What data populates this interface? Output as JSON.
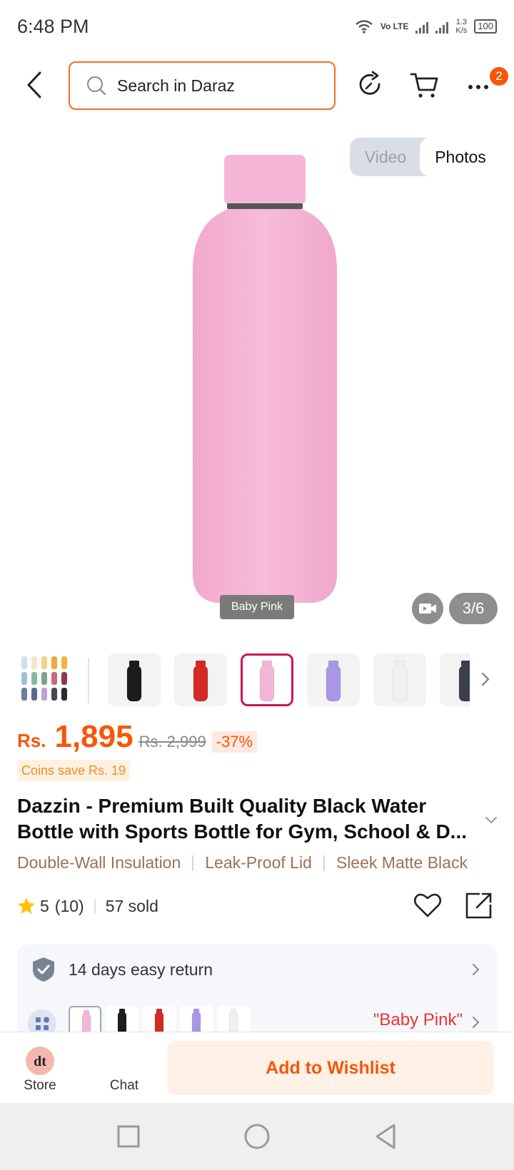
{
  "status_bar": {
    "time": "6:48 PM",
    "network": "Vo LTE",
    "speed_value": "1.3",
    "speed_unit": "K/s",
    "battery": "100"
  },
  "header": {
    "search_placeholder": "Search in Daraz",
    "cart_badge": "2"
  },
  "media": {
    "toggle_video": "Video",
    "toggle_photos": "Photos",
    "variant_tag": "Baby Pink",
    "image_counter": "3/6"
  },
  "thumbnails": {
    "colors": [
      "#1c1c1c",
      "#d42a26",
      "#f2b6d6",
      "#a996e6",
      "#f1f0ee",
      "#3a3f4a"
    ]
  },
  "price": {
    "currency": "Rs.",
    "current": "1,895",
    "original": "Rs. 2,999",
    "discount": "-37%",
    "coins": "Coins save Rs. 19"
  },
  "product": {
    "title": "Dazzin - Premium Built Quality Black Water Bottle with Sports Bottle for Gym, School & D...",
    "features": [
      "Double-Wall Insulation",
      "Leak-Proof Lid",
      "Sleek Matte Black"
    ],
    "rating": "5",
    "reviews": "(10)",
    "sold": "57 sold"
  },
  "services": {
    "return_text": "14 days easy return",
    "selected_variant": "\"Baby Pink\""
  },
  "actions": {
    "store_label": "Store",
    "chat_label": "Chat",
    "wishlist_label": "Add to Wishlist"
  },
  "colors": {
    "brand_orange": "#f85606",
    "bottle_pink": "#f5b3d4"
  }
}
